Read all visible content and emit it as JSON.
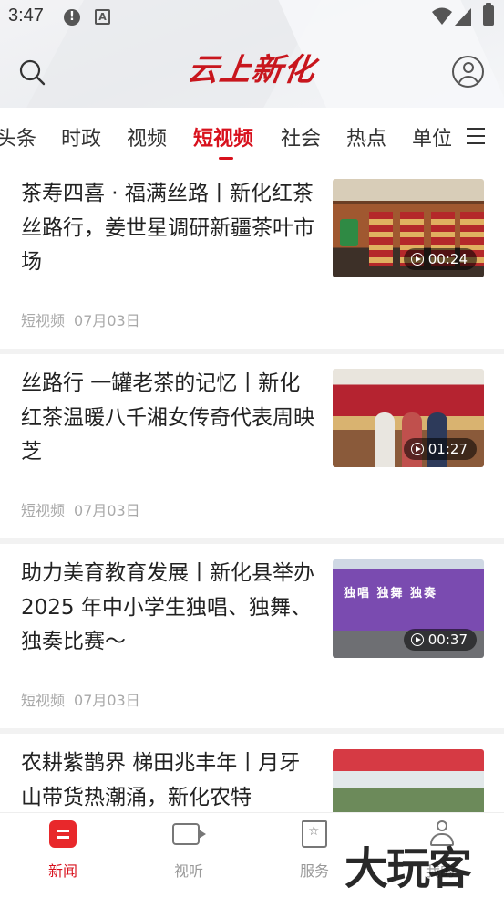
{
  "status_bar": {
    "time": "3:47"
  },
  "header": {
    "logo_text": "云上新化"
  },
  "tabs": [
    {
      "label": "头条"
    },
    {
      "label": "时政"
    },
    {
      "label": "视频"
    },
    {
      "label": "短视频",
      "active": true
    },
    {
      "label": "社会"
    },
    {
      "label": "热点"
    },
    {
      "label": "单位"
    }
  ],
  "feed": [
    {
      "title": "茶寿四喜 · 福满丝路丨新化红茶丝路行，姜世星调研新疆茶叶市场",
      "source": "短视频",
      "date": "07月03日",
      "duration": "00:24"
    },
    {
      "title": "丝路行 一罐老茶的记忆丨新化红茶温暖八千湘女传奇代表周映芝",
      "source": "短视频",
      "date": "07月03日",
      "duration": "01:27"
    },
    {
      "title": "助力美育教育发展丨新化县举办 2025 年中小学生独唱、独舞、独奏比赛～",
      "source": "短视频",
      "date": "07月03日",
      "duration": "00:37",
      "thumb_banner": "独唱 独舞 独奏"
    },
    {
      "title": "农耕紫鹊界 梯田兆丰年丨月牙山带货热潮涌，新化农特",
      "source": "",
      "date": "",
      "duration": ""
    }
  ],
  "bottom_nav": [
    {
      "label": "新闻",
      "active": true
    },
    {
      "label": "视听"
    },
    {
      "label": "服务"
    },
    {
      "label": "我的"
    }
  ],
  "watermark": "大玩客",
  "colors": {
    "accent": "#d8111d",
    "news_icon": "#e8282b",
    "meta_gray": "#a9a9a9"
  }
}
